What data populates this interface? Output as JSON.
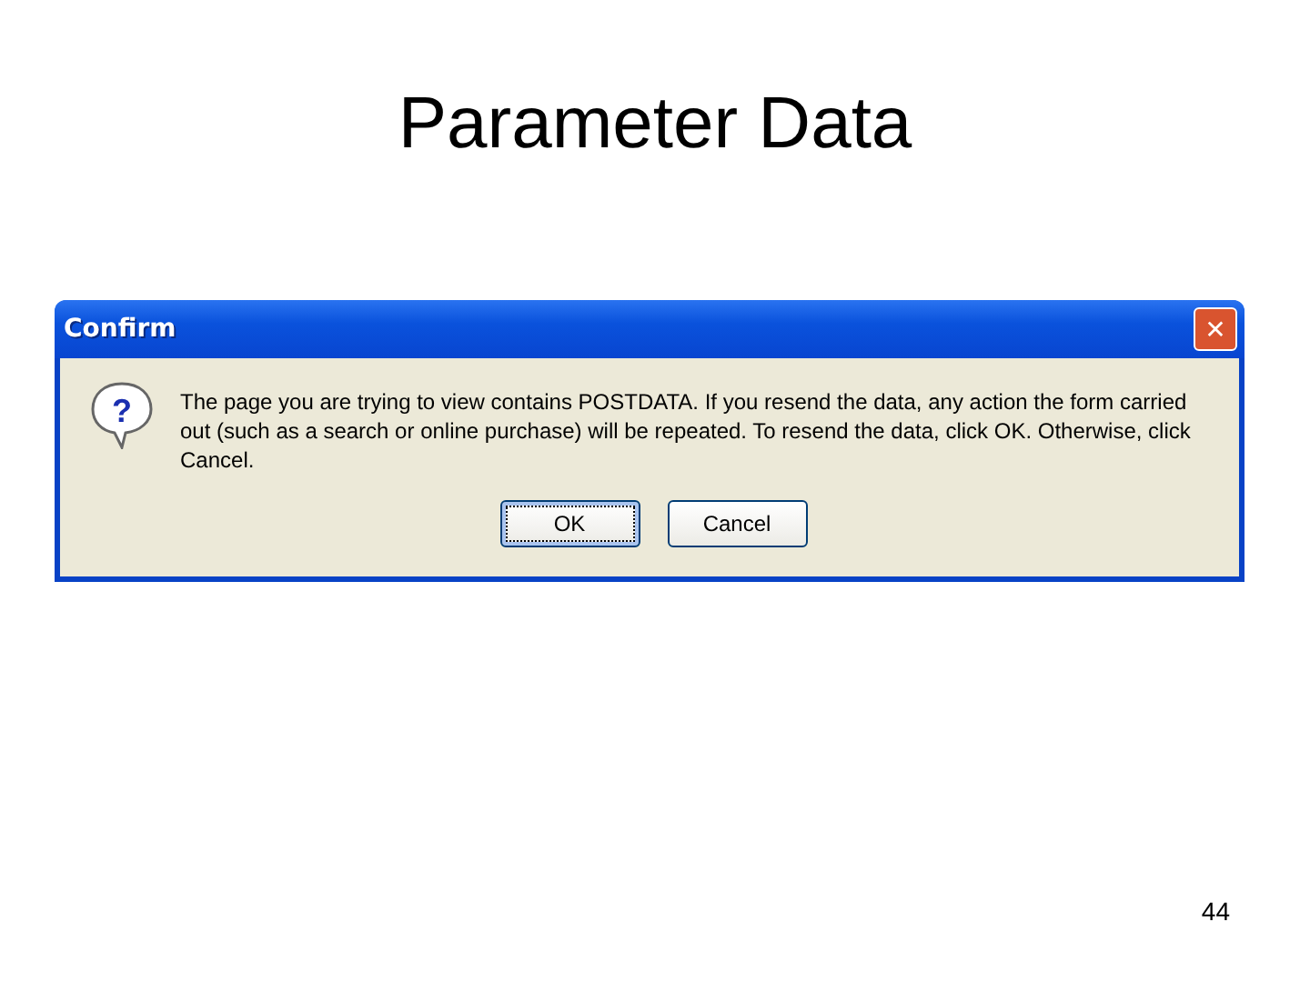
{
  "slide": {
    "title": "Parameter Data",
    "page_number": "44"
  },
  "dialog": {
    "title": "Confirm",
    "close_glyph": "✕",
    "icon_glyph": "?",
    "message": "The page you are trying to view contains POSTDATA. If you resend the data, any action the form carried out (such as a search or online purchase) will be repeated. To resend the data, click OK. Otherwise, click Cancel.",
    "buttons": [
      {
        "label": "OK",
        "focused": true
      },
      {
        "label": "Cancel",
        "focused": false
      }
    ]
  }
}
